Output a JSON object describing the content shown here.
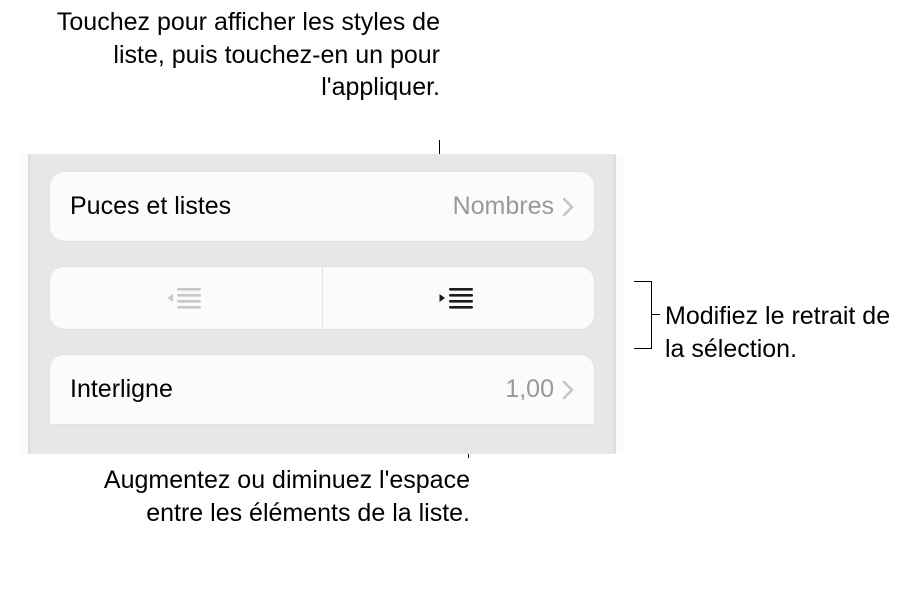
{
  "callouts": {
    "top": "Touchez pour afficher les styles de liste, puis touchez-en un pour l'appliquer.",
    "right": "Modifiez le retrait de la sélection.",
    "bottom": "Augmentez ou diminuez l'espace entre les éléments de la liste."
  },
  "panel": {
    "bullets": {
      "label": "Puces et listes",
      "value": "Nombres"
    },
    "indent": {
      "outdent_icon": "outdent-icon",
      "indent_icon": "indent-icon"
    },
    "linespacing": {
      "label": "Interligne",
      "value": "1,00"
    }
  }
}
